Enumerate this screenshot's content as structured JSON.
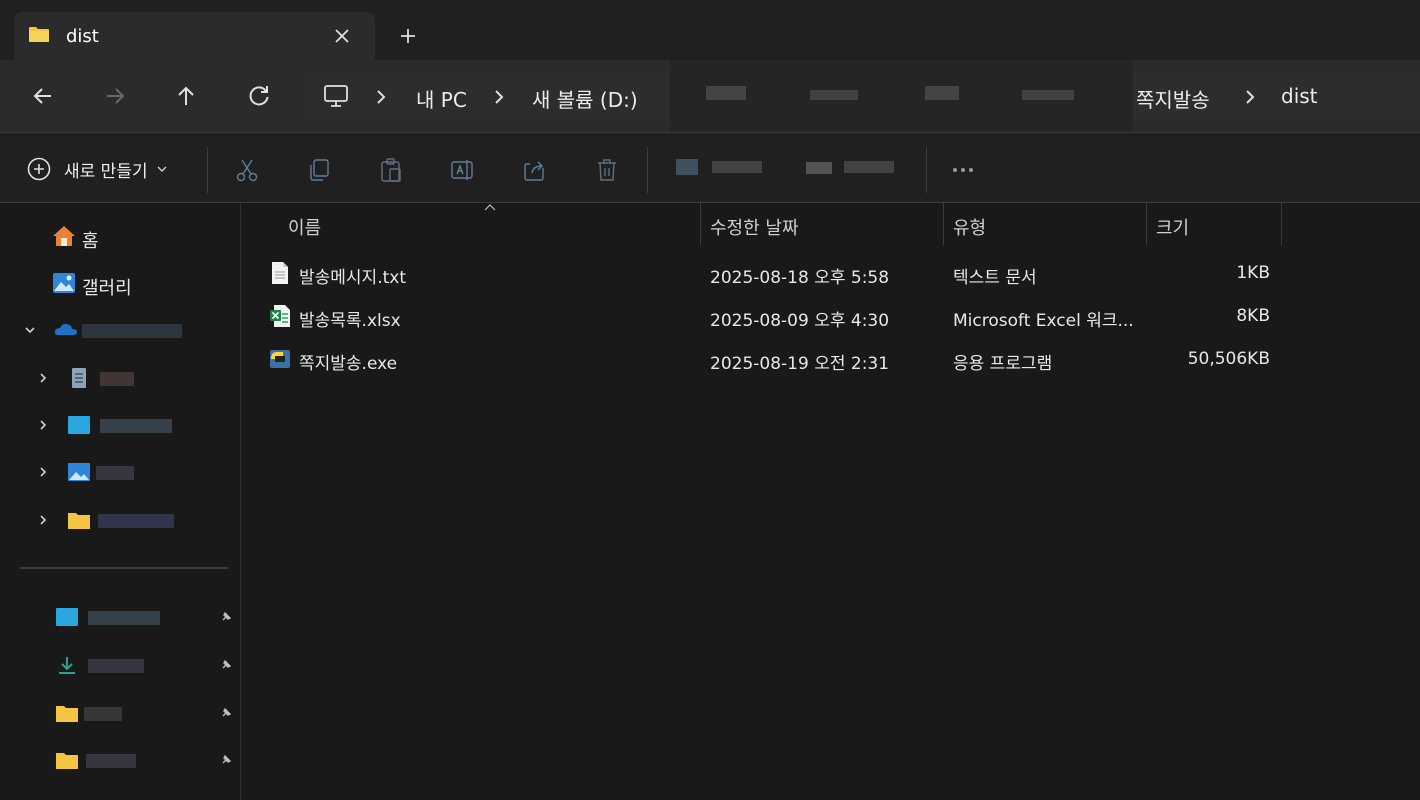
{
  "tab": {
    "title": "dist",
    "close_icon": "close-icon",
    "new_tab_icon": "plus-icon"
  },
  "nav": {
    "back_icon": "arrow-left-icon",
    "forward_icon": "arrow-right-icon",
    "up_icon": "arrow-up-icon",
    "refresh_icon": "refresh-icon",
    "breadcrumb": {
      "pc_icon": "monitor-icon",
      "items": [
        "내 PC",
        "새 볼륨 (D:)",
        "쪽지발송",
        "dist"
      ]
    }
  },
  "command_bar": {
    "new_label": "새로 만들기",
    "icons": [
      "cut-icon",
      "copy-icon",
      "paste-icon",
      "rename-icon",
      "share-icon",
      "delete-icon",
      "more-icon"
    ]
  },
  "sidebar": {
    "items": [
      {
        "label": "홈",
        "icon": "home-icon"
      },
      {
        "label": "갤러리",
        "icon": "gallery-icon"
      }
    ]
  },
  "columns": {
    "name": "이름",
    "modified": "수정한 날짜",
    "type": "유형",
    "size": "크기"
  },
  "files": [
    {
      "name": "발송메시지.txt",
      "modified": "2025-08-18 오후 5:58",
      "type": "텍스트 문서",
      "size": "1KB",
      "icon": "text-file-icon"
    },
    {
      "name": "발송목록.xlsx",
      "modified": "2025-08-09 오후 4:30",
      "type": "Microsoft Excel 워크...",
      "size": "8KB",
      "icon": "excel-file-icon"
    },
    {
      "name": "쪽지발송.exe",
      "modified": "2025-08-19 오전 2:31",
      "type": "응용 프로그램",
      "size": "50,506KB",
      "icon": "python-exe-icon"
    }
  ],
  "colors": {
    "folder": "#f4c542",
    "accent": "#4ca3e0",
    "excel": "#1d8348"
  }
}
